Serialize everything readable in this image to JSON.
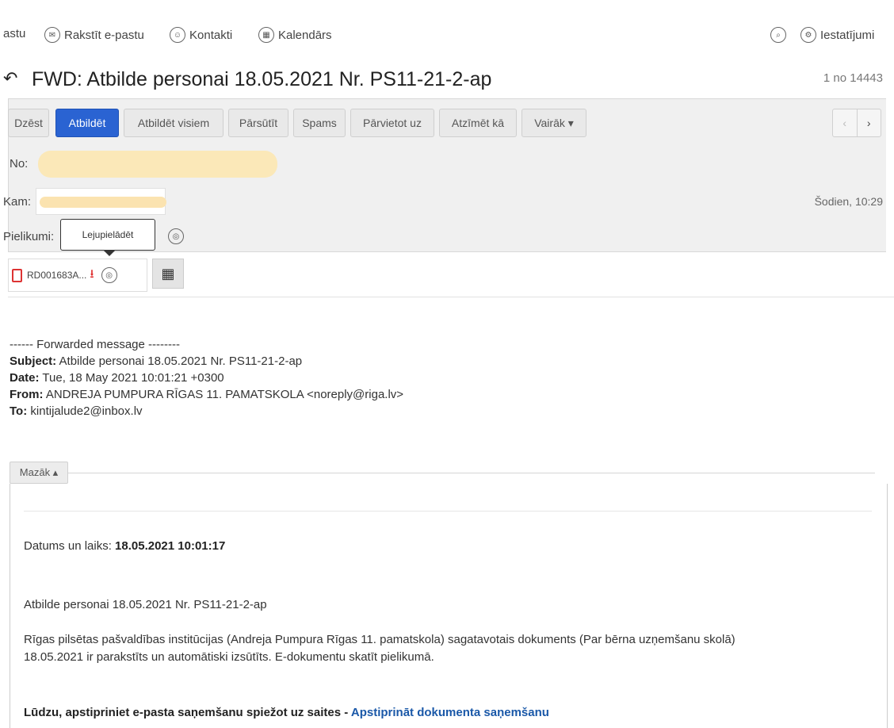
{
  "topnav": {
    "items": [
      "astu",
      "Rakstīt e-pastu",
      "Kontakti",
      "Kalendārs"
    ],
    "settings": "Iestatījumi"
  },
  "message": {
    "subject": "FWD: Atbilde personai 18.05.2021 Nr. PS11-21-2-ap",
    "counter": "1 no 14443"
  },
  "toolbar": {
    "buttons": [
      "Dzēst",
      "Atbildēt",
      "Atbildēt visiem",
      "Pārsūtīt",
      "Spams",
      "Pārvietot uz",
      "Atzīmēt kā",
      "Vairāk ▾"
    ],
    "prev": "‹",
    "next": "›"
  },
  "header": {
    "to_label": "No:",
    "from_label": "Kam:",
    "attach_label": "Pielikumi:",
    "date": "Šodien, 10:29"
  },
  "tooltip": "Lejupielādēt",
  "attachment": {
    "name": "RD001683A..."
  },
  "forwarded": {
    "header": "------ Forwarded message --------",
    "subject_label": "Subject:",
    "subject": "Atbilde personai 18.05.2021 Nr. PS11-21-2-ap",
    "date_label": "Date:",
    "date": "Tue, 18 May 2021 10:01:21 +0300",
    "from_label": "From:",
    "from": "ANDREJA PUMPURA RĪGAS 11. PAMATSKOLA <noreply@riga.lv>",
    "to_label": "To:",
    "to": "kintijalude2@inbox.lv"
  },
  "less_button": "Mazāk ▴",
  "body": {
    "datetime_label": "Datums un laiks:",
    "datetime": "18.05.2021 10:01:17",
    "title": "Atbilde personai 18.05.2021 Nr. PS11-21-2-ap",
    "paragraph1": "Rīgas pilsētas pašvaldības institūcijas (Andreja Pumpura Rīgas 11. pamatskola) sagatavotais dokuments (Par bērna uzņemšanu skolā)",
    "paragraph2": "18.05.2021 ir parakstīts un automātiski izsūtīts. E-dokumentu skatīt pielikumā.",
    "confirm_text": "Lūdzu, apstipriniet e-pasta saņemšanu spiežot uz saites - ",
    "confirm_link": "Apstiprināt dokumenta saņemšanu"
  }
}
